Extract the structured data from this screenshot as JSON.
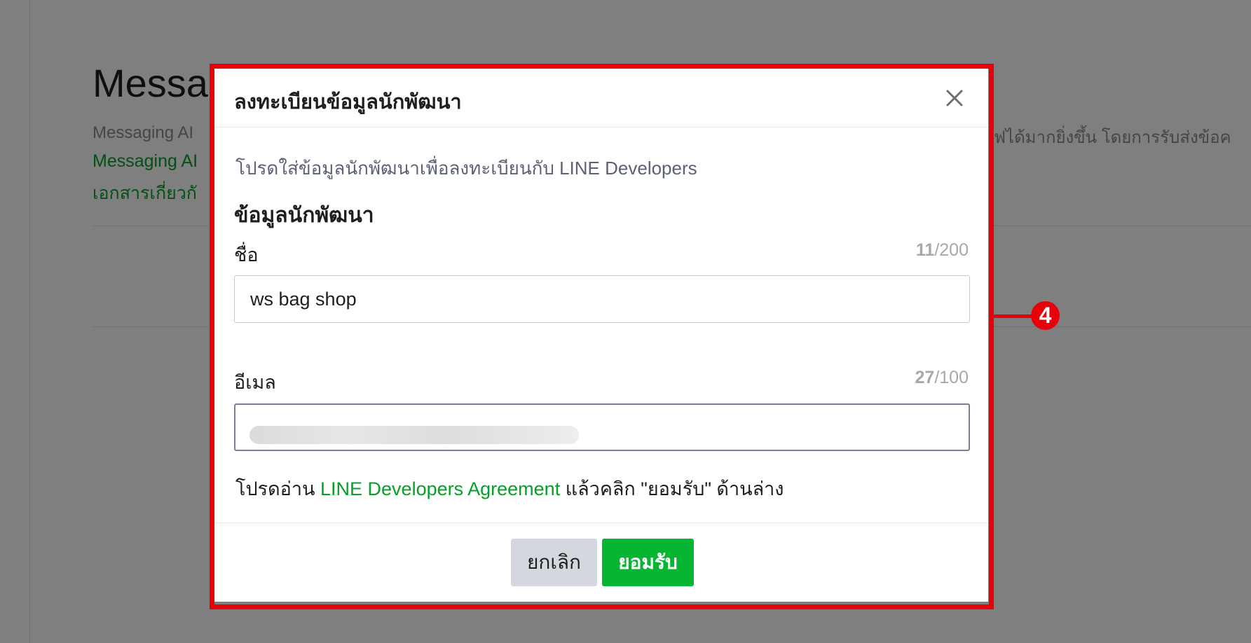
{
  "background": {
    "page_title": "Messa",
    "description_left": "Messaging AI",
    "description_right": "ฟได้มากยิ่งขึ้น โดยการรับส่งข้อค",
    "link_1": "Messaging AI",
    "link_2": "เอกสารเกี่ยวกั"
  },
  "modal": {
    "title": "ลงทะเบียนข้อมูลนักพัฒนา",
    "intro": "โปรดใส่ข้อมูลนักพัฒนาเพื่อลงทะเบียนกับ LINE Developers",
    "section_title": "ข้อมูลนักพัฒนา",
    "name_field": {
      "label": "ชื่อ",
      "count_current": "11",
      "count_max": "/200",
      "value": "ws bag shop"
    },
    "email_field": {
      "label": "อีเมล",
      "count_current": "27",
      "count_max": "/100"
    },
    "agreement": {
      "prefix": "โปรดอ่าน ",
      "link": "LINE Developers Agreement",
      "suffix": " แล้วคลิก \"ยอมรับ\" ด้านล่าง"
    },
    "buttons": {
      "cancel": "ยกเลิก",
      "accept": "ยอมรับ"
    }
  },
  "annotation": {
    "badge": "4"
  },
  "colors": {
    "accent_green": "#06b632",
    "link_green": "#06a028",
    "annotation_red": "#e8000b",
    "cancel_gray": "#d4d7de"
  },
  "icons": {
    "close": "close-icon"
  }
}
